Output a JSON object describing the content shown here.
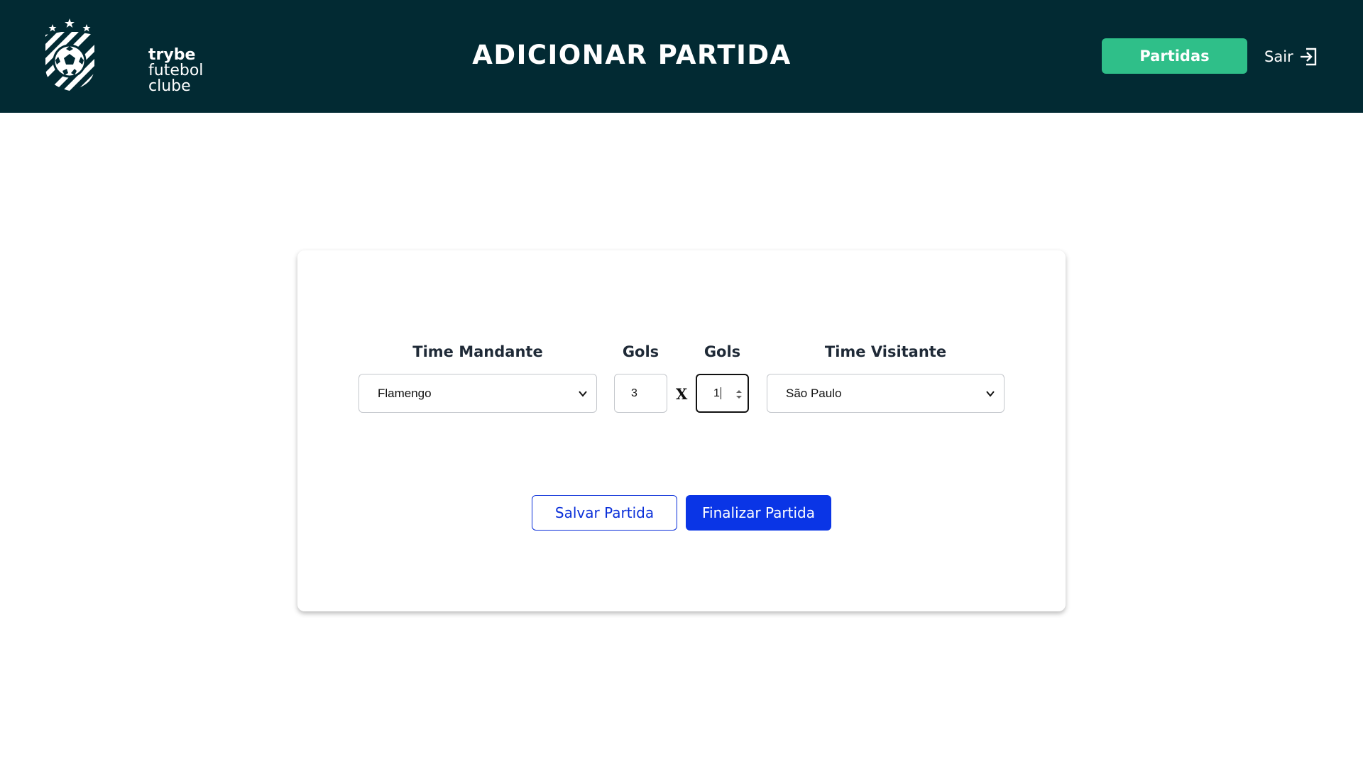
{
  "header": {
    "logo": {
      "line1": "trybe",
      "line2": "futebol",
      "line3": "clube",
      "icon": "soccer-shield-logo"
    },
    "title": "ADICIONAR PARTIDA",
    "partidas_label": "Partidas",
    "logout_label": "Sair",
    "logout_icon": "logout-arrow-icon"
  },
  "form": {
    "home_team_label": "Time Mandante",
    "home_team_value": "Flamengo",
    "home_goals_label": "Gols",
    "home_goals_value": "3",
    "versus": "X",
    "away_goals_label": "Gols",
    "away_goals_value": "1",
    "away_team_label": "Time Visitante",
    "away_team_value": "São Paulo"
  },
  "actions": {
    "save_label": "Salvar Partida",
    "finish_label": "Finalizar Partida"
  },
  "colors": {
    "header_bg": "#022a33",
    "accent_green": "#2fbf89",
    "primary_blue": "#0a35e6"
  }
}
